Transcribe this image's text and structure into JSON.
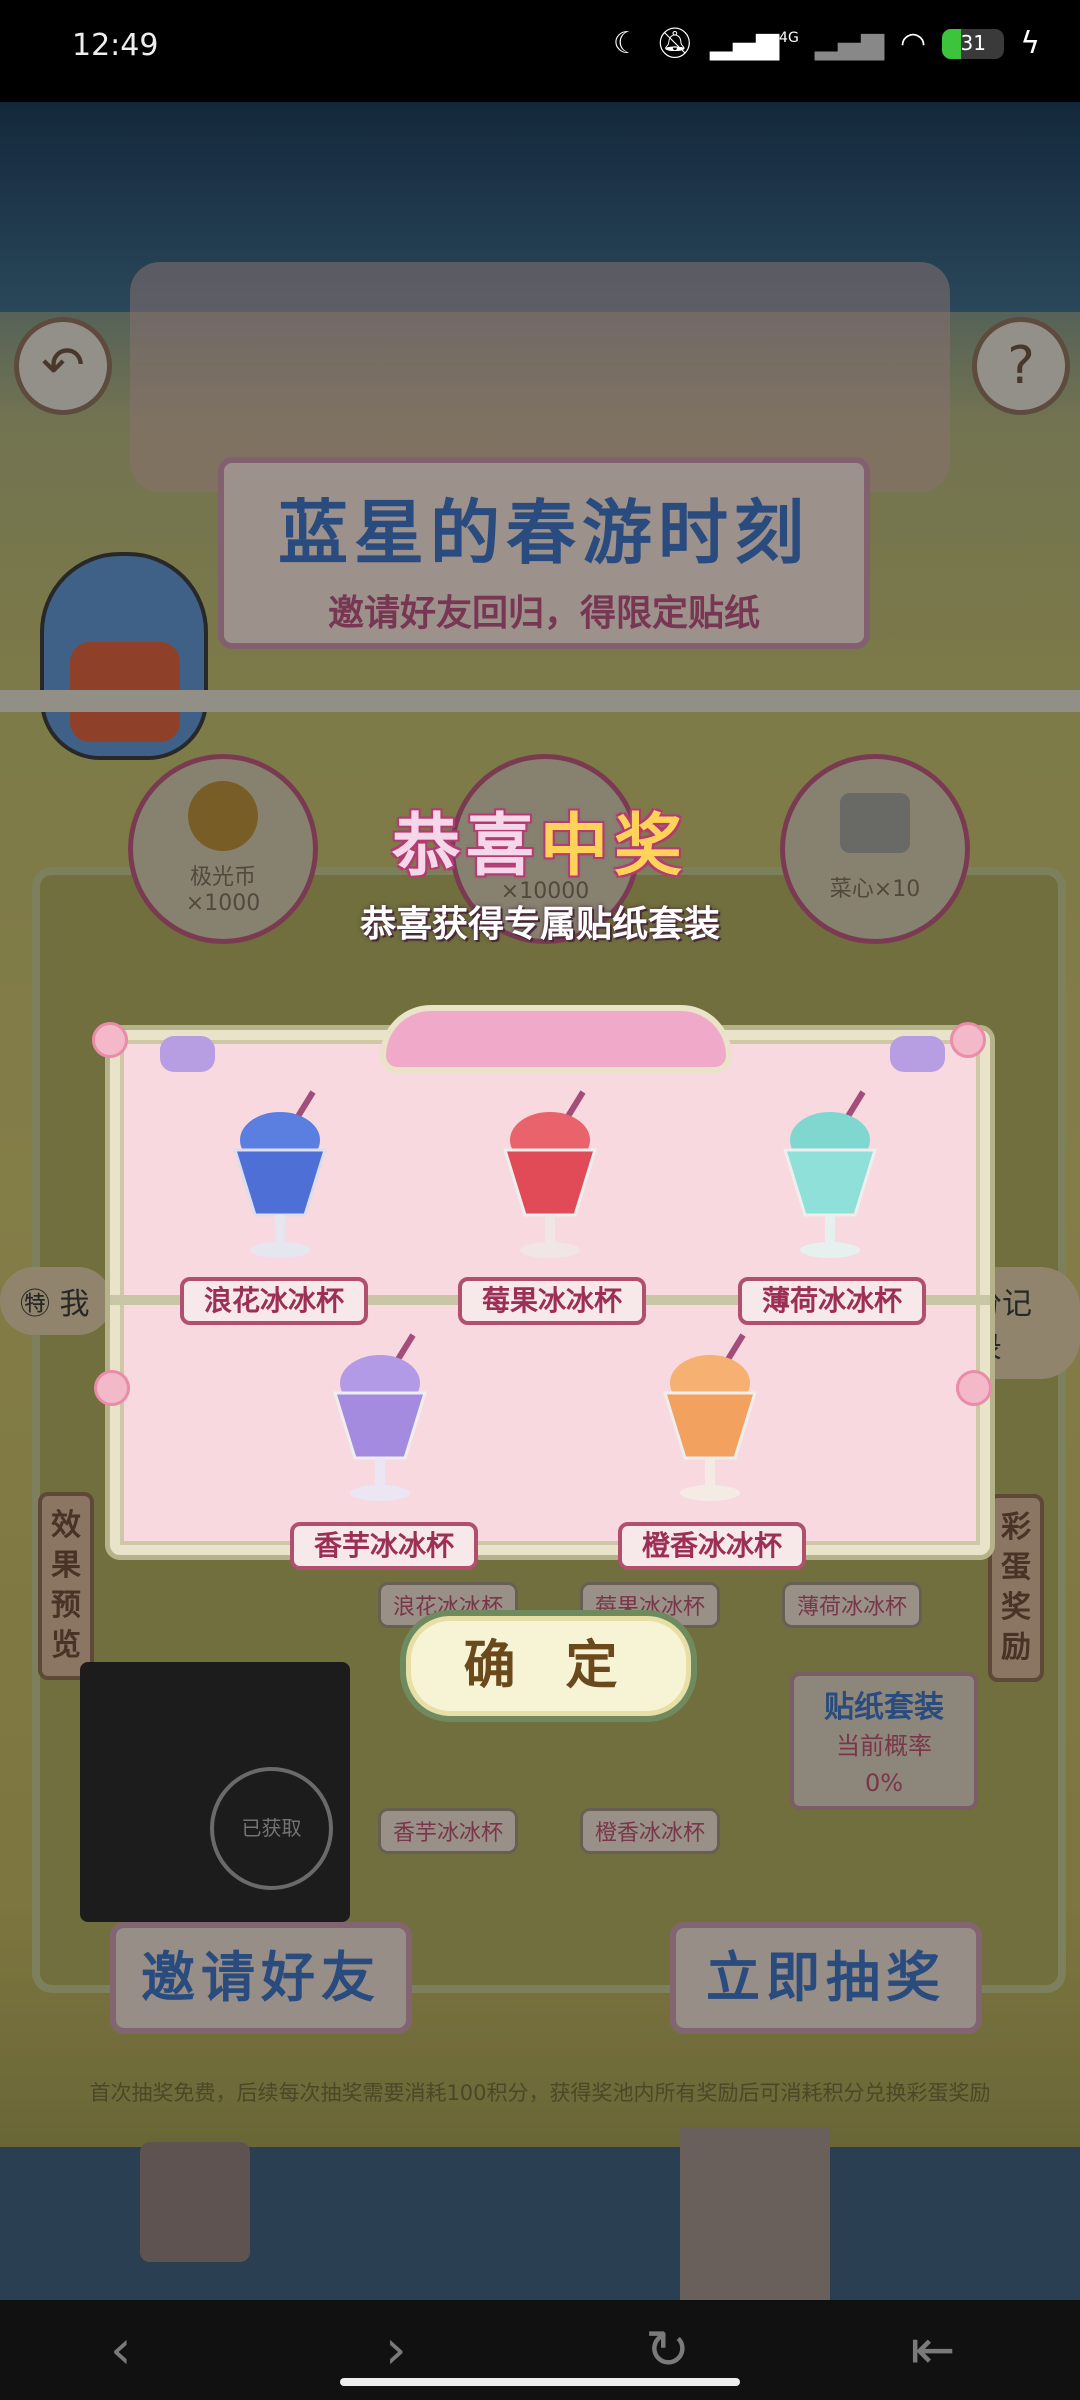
{
  "status_bar": {
    "time": "12:49",
    "network_label": "4G",
    "battery_level": 31,
    "battery_text": "31",
    "icons": [
      "moon-icon",
      "mute-icon",
      "signal-icon",
      "signal-no-sim-icon",
      "wifi-icon",
      "battery-icon",
      "charging-icon"
    ]
  },
  "background": {
    "title": "蓝星的春游时刻",
    "subtitle": "邀请好友回归，得限定贴纸",
    "rewards": [
      {
        "name": "极光币",
        "qty": "×1000"
      },
      {
        "name": "",
        "qty": "×10000"
      },
      {
        "name": "菜心",
        "qty": "×10"
      }
    ],
    "points_prefix": "我",
    "points_suffix": "分记录",
    "side_left": "效果预览",
    "side_right": "彩蛋奖励",
    "owned_stamp": "已获取",
    "probability_title": "贴纸套装",
    "probability_label": "当前概率",
    "probability_value": "0%",
    "bottom_labels_row1": [
      "浪花冰冰杯",
      "莓果冰冰杯",
      "薄荷冰冰杯"
    ],
    "bottom_labels_row2": [
      "香芋冰冰杯",
      "橙香冰冰杯"
    ],
    "invite_button": "邀请好友",
    "draw_button": "立即抽奖",
    "rules_text": "首次抽奖免费，后续每次抽奖需要消耗100积分，获得奖池内所有奖励后可消耗积分兑换彩蛋奖励"
  },
  "modal": {
    "title_part1": "恭喜",
    "title_part2": "中奖",
    "subtitle": "恭喜获得专属贴纸套装",
    "items": [
      {
        "label": "浪花冰冰杯",
        "color": "#5b7fe0"
      },
      {
        "label": "莓果冰冰杯",
        "color": "#e8636b"
      },
      {
        "label": "薄荷冰冰杯",
        "color": "#7fd7d0"
      },
      {
        "label": "香芋冰冰杯",
        "color": "#a58be0"
      },
      {
        "label": "橙香冰冰杯",
        "color": "#f2a25e"
      }
    ],
    "confirm_label": "确 定"
  },
  "nav_bar": {
    "icons": [
      "back-icon",
      "forward-icon",
      "refresh-icon",
      "exit-icon"
    ]
  },
  "colors": {
    "accent_pink": "#b14f6e",
    "card_bg": "#f7d9df",
    "title_blue": "#3f6fb8",
    "title_gold": "#ffd25a"
  }
}
